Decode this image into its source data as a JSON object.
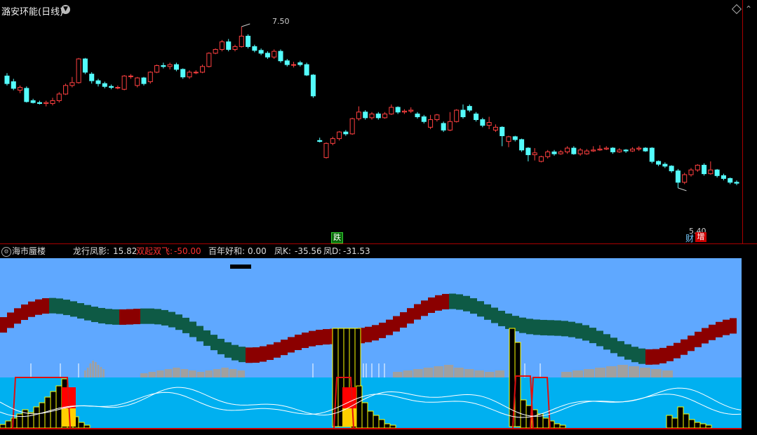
{
  "main_chart": {
    "stock_title": "潞安环能(日线)",
    "max_price_label": "7.50",
    "min_price_label": "5.40",
    "badge_die": "跌",
    "badge_cai": "财",
    "badge_zeng": "增",
    "colors": {
      "up": "#ff4040",
      "down": "#54fcfc",
      "background": "#000000",
      "separator": "#aa0000"
    }
  },
  "sub_chart": {
    "indicator_name": "海市蜃楼",
    "longxing_label": "龙行凤影: ",
    "longxing_value": "15.82",
    "shuangqi_label": "双起双飞: ",
    "shuangqi_value": "-50.00",
    "bainian_label": "百年好和: ",
    "bainian_value": "0.00",
    "fengk_label": "凤K: ",
    "fengk_value": "-35.56",
    "fengd_label": "凤D: ",
    "fengd_value": "-31.53",
    "colors": {
      "sky": "#5fa8ff",
      "sea": "#00b0f0",
      "dark_red": "#8b0000",
      "dark_green": "#0e5a45",
      "gray": "#a0a0a0"
    }
  },
  "chart_data": {
    "type": "candlestick",
    "title": "潞安环能(日线)",
    "max_label": 7.5,
    "min_label": 5.4,
    "candles": [
      {
        "o": 6.98,
        "c": 6.9,
        "h": 7.01,
        "l": 6.88
      },
      {
        "o": 6.92,
        "c": 6.85,
        "h": 6.95,
        "l": 6.83
      },
      {
        "o": 6.83,
        "c": 6.86,
        "h": 6.88,
        "l": 6.8
      },
      {
        "o": 6.85,
        "c": 6.71,
        "h": 6.87,
        "l": 6.7
      },
      {
        "o": 6.72,
        "c": 6.7,
        "h": 6.74,
        "l": 6.69
      },
      {
        "o": 6.7,
        "c": 6.69,
        "h": 6.72,
        "l": 6.68
      },
      {
        "o": 6.69,
        "c": 6.7,
        "h": 6.72,
        "l": 6.66
      },
      {
        "o": 6.69,
        "c": 6.72,
        "h": 6.75,
        "l": 6.67
      },
      {
        "o": 6.72,
        "c": 6.79,
        "h": 6.81,
        "l": 6.7
      },
      {
        "o": 6.79,
        "c": 6.88,
        "h": 6.9,
        "l": 6.78
      },
      {
        "o": 6.88,
        "c": 6.91,
        "h": 6.97,
        "l": 6.86
      },
      {
        "o": 6.91,
        "c": 7.16,
        "h": 7.17,
        "l": 6.9
      },
      {
        "o": 7.16,
        "c": 7.02,
        "h": 7.17,
        "l": 7.0
      },
      {
        "o": 7.0,
        "c": 6.93,
        "h": 7.02,
        "l": 6.9
      },
      {
        "o": 6.93,
        "c": 6.9,
        "h": 6.95,
        "l": 6.87
      },
      {
        "o": 6.9,
        "c": 6.87,
        "h": 6.92,
        "l": 6.85
      },
      {
        "o": 6.87,
        "c": 6.86,
        "h": 6.89,
        "l": 6.84
      },
      {
        "o": 6.86,
        "c": 6.86,
        "h": 6.88,
        "l": 6.84
      },
      {
        "o": 6.84,
        "c": 6.98,
        "h": 6.99,
        "l": 6.83
      },
      {
        "o": 6.98,
        "c": 6.98,
        "h": 7.0,
        "l": 6.95
      },
      {
        "o": 6.88,
        "c": 6.96,
        "h": 6.97,
        "l": 6.86
      },
      {
        "o": 6.96,
        "c": 6.9,
        "h": 6.97,
        "l": 6.88
      },
      {
        "o": 6.92,
        "c": 7.02,
        "h": 7.03,
        "l": 6.9
      },
      {
        "o": 7.02,
        "c": 7.09,
        "h": 7.1,
        "l": 7.01
      },
      {
        "o": 7.09,
        "c": 7.08,
        "h": 7.12,
        "l": 7.06
      },
      {
        "o": 7.08,
        "c": 7.1,
        "h": 7.12,
        "l": 7.05
      },
      {
        "o": 7.1,
        "c": 7.05,
        "h": 7.12,
        "l": 7.03
      },
      {
        "o": 7.05,
        "c": 6.97,
        "h": 7.06,
        "l": 6.95
      },
      {
        "o": 6.97,
        "c": 7.02,
        "h": 7.04,
        "l": 6.95
      },
      {
        "o": 7.02,
        "c": 7.02,
        "h": 7.04,
        "l": 7.0
      },
      {
        "o": 7.02,
        "c": 7.08,
        "h": 7.1,
        "l": 7.01
      },
      {
        "o": 7.08,
        "c": 7.22,
        "h": 7.23,
        "l": 7.07
      },
      {
        "o": 7.22,
        "c": 7.26,
        "h": 7.27,
        "l": 7.21
      },
      {
        "o": 7.26,
        "c": 7.34,
        "h": 7.36,
        "l": 7.24
      },
      {
        "o": 7.34,
        "c": 7.26,
        "h": 7.37,
        "l": 7.24
      },
      {
        "o": 7.26,
        "c": 7.29,
        "h": 7.31,
        "l": 7.24
      },
      {
        "o": 7.29,
        "c": 7.4,
        "h": 7.5,
        "l": 7.28
      },
      {
        "o": 7.4,
        "c": 7.29,
        "h": 7.42,
        "l": 7.27
      },
      {
        "o": 7.29,
        "c": 7.25,
        "h": 7.31,
        "l": 7.23
      },
      {
        "o": 7.25,
        "c": 7.22,
        "h": 7.27,
        "l": 7.2
      },
      {
        "o": 7.22,
        "c": 7.18,
        "h": 7.24,
        "l": 7.16
      },
      {
        "o": 7.18,
        "c": 7.24,
        "h": 7.26,
        "l": 7.16
      },
      {
        "o": 7.24,
        "c": 7.14,
        "h": 7.26,
        "l": 7.12
      },
      {
        "o": 7.14,
        "c": 7.1,
        "h": 7.16,
        "l": 7.08
      },
      {
        "o": 7.1,
        "c": 7.1,
        "h": 7.13,
        "l": 7.07
      },
      {
        "o": 7.12,
        "c": 7.1,
        "h": 7.14,
        "l": 7.08
      },
      {
        "o": 7.1,
        "c": 6.99,
        "h": 7.12,
        "l": 6.98
      },
      {
        "o": 6.99,
        "c": 6.77,
        "h": 7.0,
        "l": 6.75
      },
      {
        "o": 6.3,
        "c": 6.29,
        "h": 6.33,
        "l": 6.28
      },
      {
        "o": 6.12,
        "c": 6.27,
        "h": 6.28,
        "l": 6.11
      },
      {
        "o": 6.27,
        "c": 6.32,
        "h": 6.34,
        "l": 6.25
      },
      {
        "o": 6.32,
        "c": 6.39,
        "h": 6.4,
        "l": 6.3
      },
      {
        "o": 6.39,
        "c": 6.37,
        "h": 6.41,
        "l": 6.35
      },
      {
        "o": 6.37,
        "c": 6.53,
        "h": 6.54,
        "l": 6.36
      },
      {
        "o": 6.53,
        "c": 6.6,
        "h": 6.66,
        "l": 6.51
      },
      {
        "o": 6.6,
        "c": 6.54,
        "h": 6.62,
        "l": 6.52
      },
      {
        "o": 6.54,
        "c": 6.58,
        "h": 6.6,
        "l": 6.52
      },
      {
        "o": 6.58,
        "c": 6.54,
        "h": 6.6,
        "l": 6.52
      },
      {
        "o": 6.54,
        "c": 6.58,
        "h": 6.6,
        "l": 6.53
      },
      {
        "o": 6.58,
        "c": 6.65,
        "h": 6.68,
        "l": 6.57
      },
      {
        "o": 6.65,
        "c": 6.6,
        "h": 6.66,
        "l": 6.58
      },
      {
        "o": 6.6,
        "c": 6.61,
        "h": 6.63,
        "l": 6.58
      },
      {
        "o": 6.61,
        "c": 6.62,
        "h": 6.65,
        "l": 6.59
      },
      {
        "o": 6.58,
        "c": 6.55,
        "h": 6.6,
        "l": 6.53
      },
      {
        "o": 6.55,
        "c": 6.5,
        "h": 6.57,
        "l": 6.48
      },
      {
        "o": 6.44,
        "c": 6.52,
        "h": 6.57,
        "l": 6.42
      },
      {
        "o": 6.52,
        "c": 6.57,
        "h": 6.58,
        "l": 6.5
      },
      {
        "o": 6.48,
        "c": 6.41,
        "h": 6.5,
        "l": 6.39
      },
      {
        "o": 6.41,
        "c": 6.5,
        "h": 6.6,
        "l": 6.4
      },
      {
        "o": 6.5,
        "c": 6.62,
        "h": 6.63,
        "l": 6.49
      },
      {
        "o": 6.62,
        "c": 6.55,
        "h": 6.68,
        "l": 6.53
      },
      {
        "o": 6.66,
        "c": 6.62,
        "h": 6.68,
        "l": 6.6
      },
      {
        "o": 6.58,
        "c": 6.52,
        "h": 6.6,
        "l": 6.5
      },
      {
        "o": 6.52,
        "c": 6.46,
        "h": 6.54,
        "l": 6.44
      },
      {
        "o": 6.46,
        "c": 6.49,
        "h": 6.55,
        "l": 6.42
      },
      {
        "o": 6.41,
        "c": 6.44,
        "h": 6.47,
        "l": 6.39
      },
      {
        "o": 6.44,
        "c": 6.35,
        "h": 6.45,
        "l": 6.24
      },
      {
        "o": 6.29,
        "c": 6.34,
        "h": 6.35,
        "l": 6.23
      },
      {
        "o": 6.34,
        "c": 6.31,
        "h": 6.35,
        "l": 6.29
      },
      {
        "o": 6.31,
        "c": 6.2,
        "h": 6.32,
        "l": 6.18
      },
      {
        "o": 6.22,
        "c": 6.15,
        "h": 6.23,
        "l": 6.08
      },
      {
        "o": 6.15,
        "c": 6.17,
        "h": 6.22,
        "l": 6.09
      },
      {
        "o": 6.08,
        "c": 6.13,
        "h": 6.14,
        "l": 6.07
      },
      {
        "o": 6.13,
        "c": 6.18,
        "h": 6.2,
        "l": 6.11
      },
      {
        "o": 6.18,
        "c": 6.16,
        "h": 6.2,
        "l": 6.14
      },
      {
        "o": 6.16,
        "c": 6.18,
        "h": 6.2,
        "l": 6.15
      },
      {
        "o": 6.18,
        "c": 6.22,
        "h": 6.24,
        "l": 6.16
      },
      {
        "o": 6.22,
        "c": 6.16,
        "h": 6.24,
        "l": 6.15
      },
      {
        "o": 6.16,
        "c": 6.2,
        "h": 6.22,
        "l": 6.14
      },
      {
        "o": 6.16,
        "c": 6.19,
        "h": 6.21,
        "l": 6.15
      },
      {
        "o": 6.19,
        "c": 6.2,
        "h": 6.24,
        "l": 6.18
      },
      {
        "o": 6.2,
        "c": 6.21,
        "h": 6.25,
        "l": 6.19
      },
      {
        "o": 6.21,
        "c": 6.22,
        "h": 6.24,
        "l": 6.2
      },
      {
        "o": 6.22,
        "c": 6.18,
        "h": 6.23,
        "l": 6.16
      },
      {
        "o": 6.18,
        "c": 6.2,
        "h": 6.22,
        "l": 6.17
      },
      {
        "o": 6.2,
        "c": 6.19,
        "h": 6.21,
        "l": 6.17
      },
      {
        "o": 6.19,
        "c": 6.21,
        "h": 6.23,
        "l": 6.18
      },
      {
        "o": 6.21,
        "c": 6.22,
        "h": 6.24,
        "l": 6.19
      },
      {
        "o": 6.22,
        "c": 6.19,
        "h": 6.23,
        "l": 6.18
      },
      {
        "o": 6.22,
        "c": 6.08,
        "h": 6.23,
        "l": 6.06
      },
      {
        "o": 6.08,
        "c": 6.05,
        "h": 6.09,
        "l": 6.03
      },
      {
        "o": 6.05,
        "c": 6.03,
        "h": 6.07,
        "l": 6.01
      },
      {
        "o": 6.03,
        "c": 5.98,
        "h": 6.04,
        "l": 5.96
      },
      {
        "o": 5.98,
        "c": 5.86,
        "h": 6.0,
        "l": 5.8
      },
      {
        "o": 5.86,
        "c": 5.94,
        "h": 5.96,
        "l": 5.84
      },
      {
        "o": 5.94,
        "c": 5.99,
        "h": 6.01,
        "l": 5.92
      },
      {
        "o": 5.99,
        "c": 6.04,
        "h": 6.05,
        "l": 5.97
      },
      {
        "o": 6.04,
        "c": 5.95,
        "h": 6.06,
        "l": 5.93
      },
      {
        "o": 5.95,
        "c": 5.99,
        "h": 6.08,
        "l": 5.94
      },
      {
        "o": 5.99,
        "c": 5.93,
        "h": 6.0,
        "l": 5.91
      },
      {
        "o": 5.93,
        "c": 5.9,
        "h": 5.95,
        "l": 5.88
      },
      {
        "o": 5.9,
        "c": 5.86,
        "h": 5.91,
        "l": 5.84
      },
      {
        "o": 5.86,
        "c": 5.85,
        "h": 5.88,
        "l": 5.83
      }
    ]
  }
}
